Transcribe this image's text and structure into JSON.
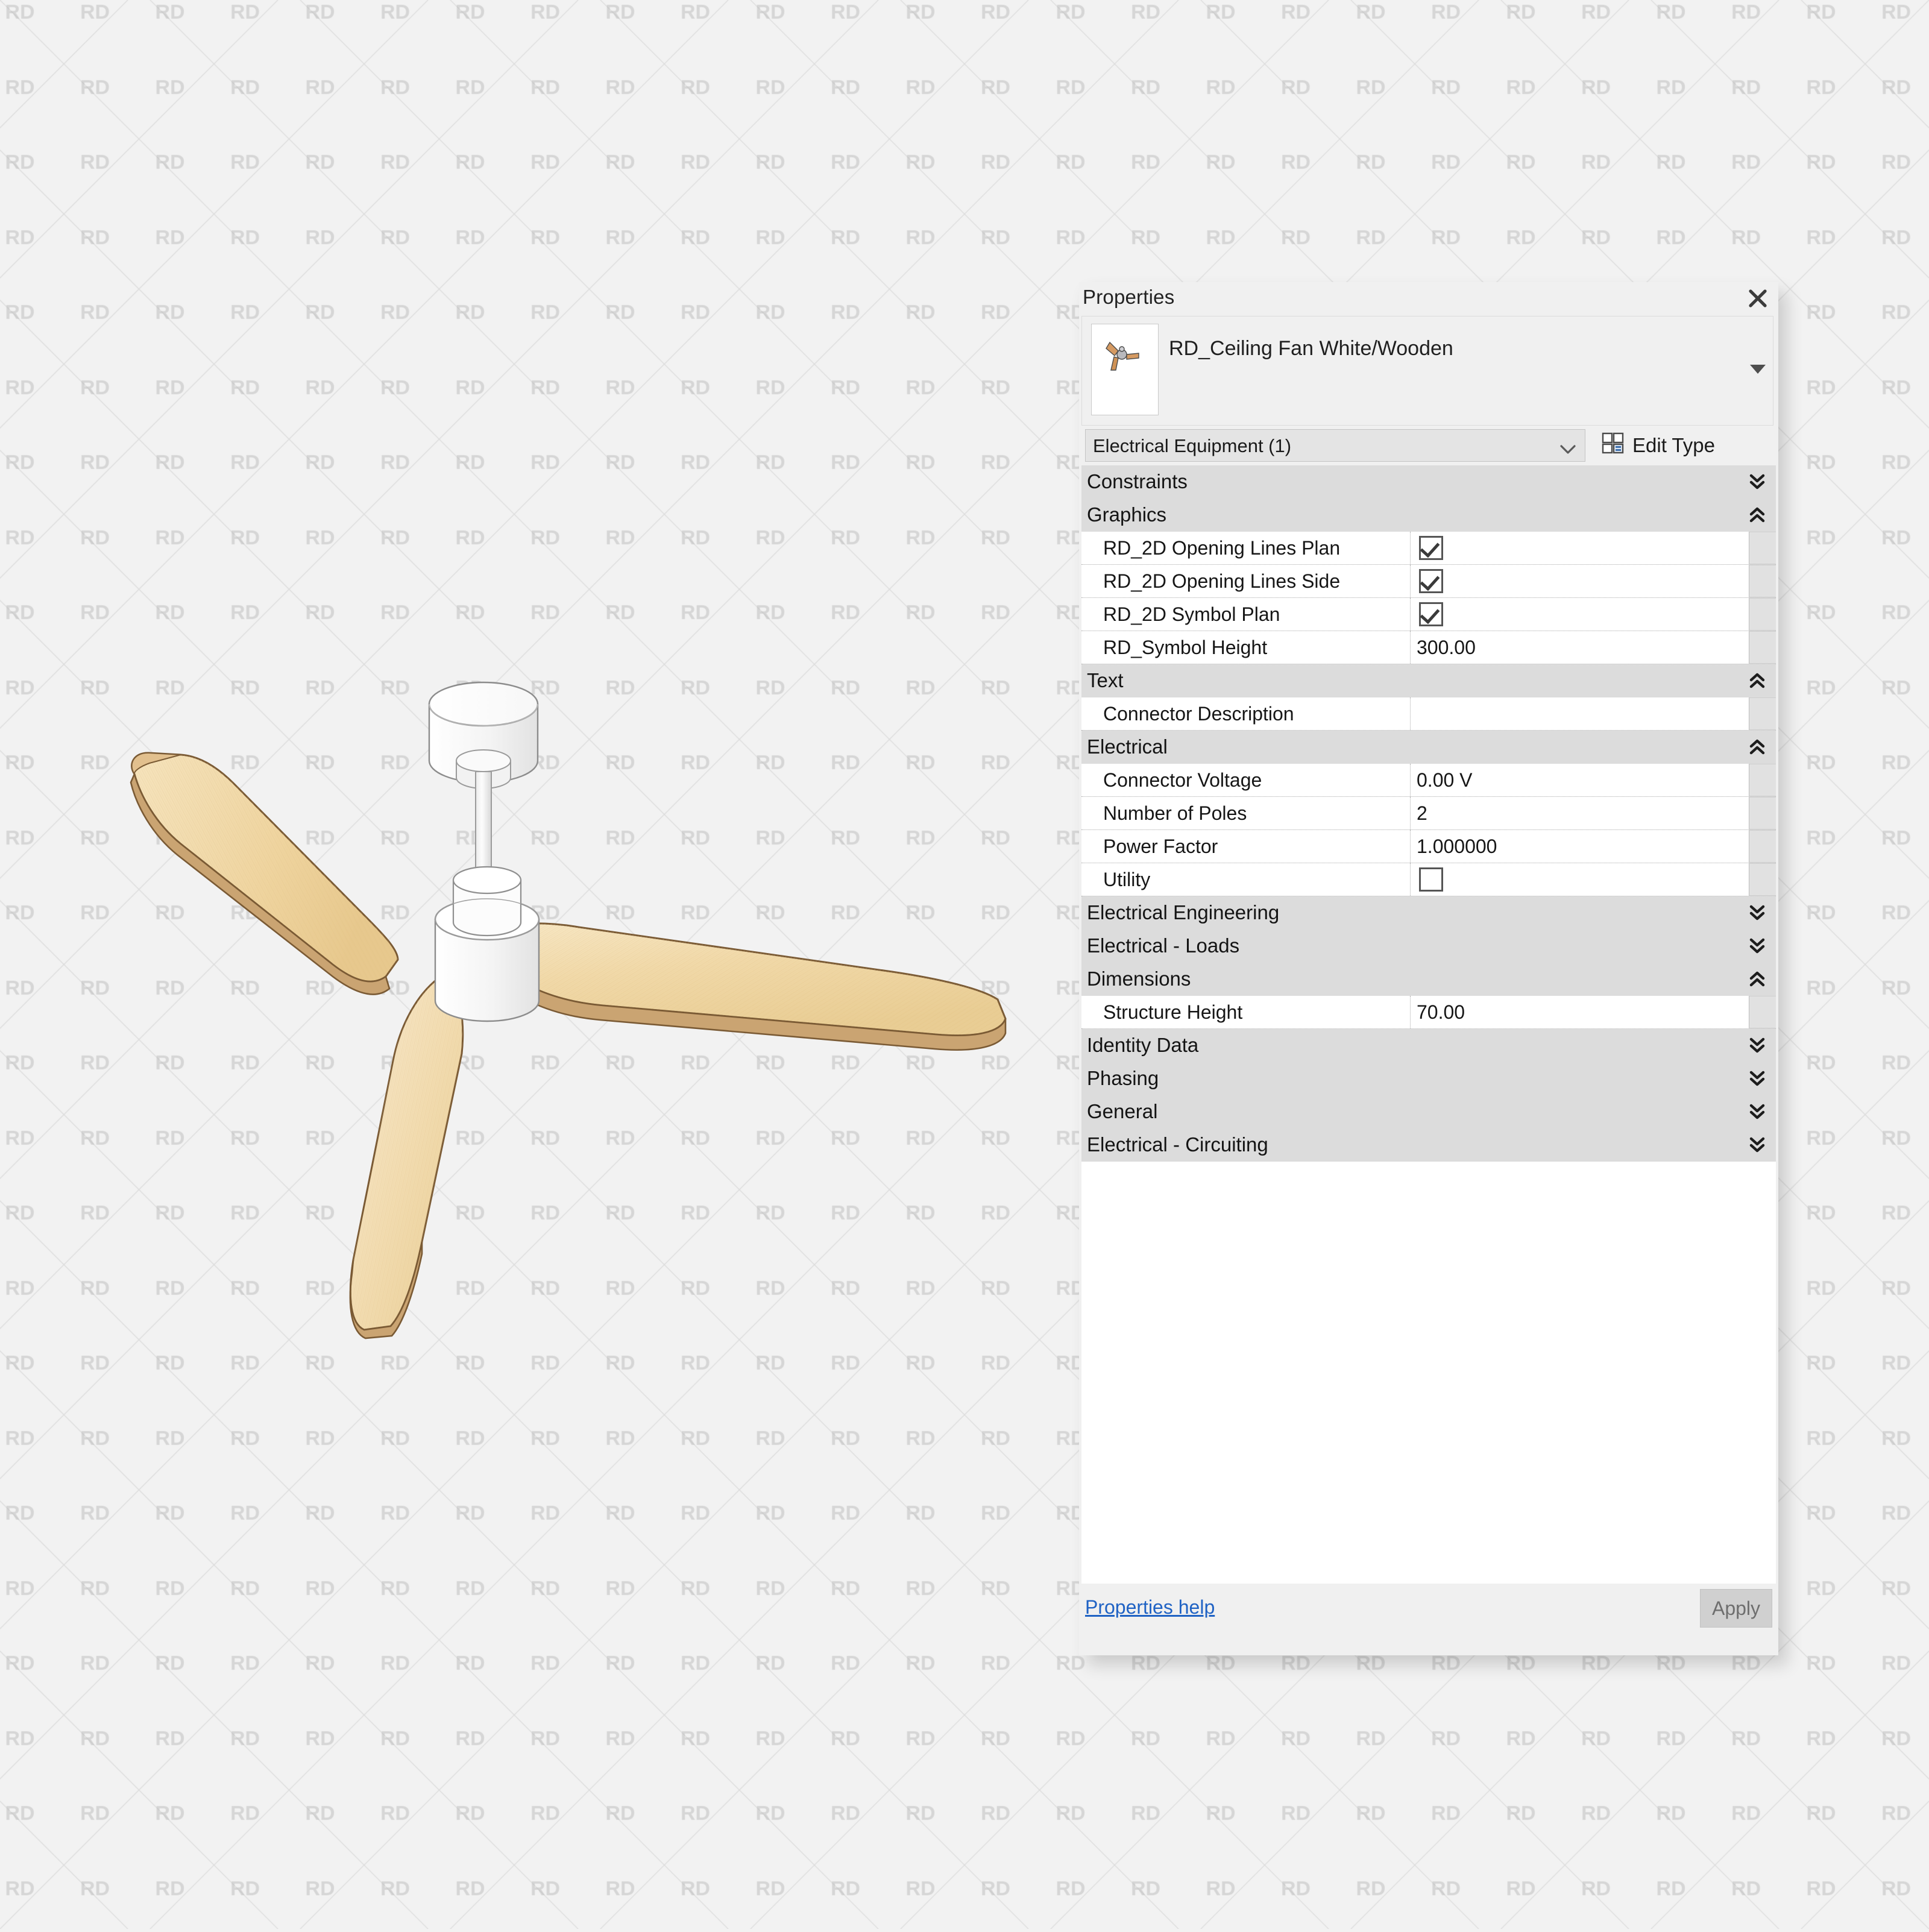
{
  "palette": {
    "title": "Properties",
    "close_icon": "close-icon",
    "family": {
      "name": "RD_Ceiling Fan White/Wooden",
      "thumbnail_icon": "ceiling-fan-thumbnail",
      "caret_icon": "caret-down-icon"
    },
    "type_selector": {
      "value": "Electrical Equipment (1)",
      "chevron_icon": "chevron-down-icon"
    },
    "edit_type": {
      "label": "Edit Type",
      "icon": "edit-type-icon"
    },
    "groups": [
      {
        "name": "Constraints",
        "state": "collapsed",
        "chevron_icon": "double-chevron-down-icon",
        "rows": []
      },
      {
        "name": "Graphics",
        "state": "expanded",
        "chevron_icon": "double-chevron-up-icon",
        "rows": [
          {
            "label": "RD_2D Opening Lines Plan",
            "type": "checkbox",
            "checked": true,
            "value": ""
          },
          {
            "label": "RD_2D Opening Lines Side",
            "type": "checkbox",
            "checked": true,
            "value": ""
          },
          {
            "label": "RD_2D Symbol Plan",
            "type": "checkbox",
            "checked": true,
            "value": ""
          },
          {
            "label": "RD_Symbol Height",
            "type": "text",
            "checked": false,
            "value": "300.00"
          }
        ]
      },
      {
        "name": "Text",
        "state": "expanded",
        "chevron_icon": "double-chevron-up-icon",
        "rows": [
          {
            "label": "Connector Description",
            "type": "text",
            "checked": false,
            "value": ""
          }
        ]
      },
      {
        "name": "Electrical",
        "state": "expanded",
        "chevron_icon": "double-chevron-up-icon",
        "rows": [
          {
            "label": "Connector Voltage",
            "type": "text",
            "checked": false,
            "value": "0.00 V"
          },
          {
            "label": "Number of Poles",
            "type": "text",
            "checked": false,
            "value": "2"
          },
          {
            "label": "Power Factor",
            "type": "text",
            "checked": false,
            "value": "1.000000"
          },
          {
            "label": "Utility",
            "type": "checkbox",
            "checked": false,
            "value": ""
          }
        ]
      },
      {
        "name": "Electrical Engineering",
        "state": "collapsed",
        "chevron_icon": "double-chevron-down-icon",
        "rows": []
      },
      {
        "name": "Electrical - Loads",
        "state": "collapsed",
        "chevron_icon": "double-chevron-down-icon",
        "rows": []
      },
      {
        "name": "Dimensions",
        "state": "expanded",
        "chevron_icon": "double-chevron-up-icon",
        "rows": [
          {
            "label": "Structure Height",
            "type": "text",
            "checked": false,
            "value": "70.00"
          }
        ]
      },
      {
        "name": "Identity Data",
        "state": "collapsed",
        "chevron_icon": "double-chevron-down-icon",
        "rows": []
      },
      {
        "name": "Phasing",
        "state": "collapsed",
        "chevron_icon": "double-chevron-down-icon",
        "rows": []
      },
      {
        "name": "General",
        "state": "collapsed",
        "chevron_icon": "double-chevron-down-icon",
        "rows": []
      },
      {
        "name": "Electrical - Circuiting",
        "state": "collapsed",
        "chevron_icon": "double-chevron-down-icon",
        "rows": []
      }
    ],
    "footer": {
      "help_label": "Properties help",
      "apply_label": "Apply"
    }
  },
  "canvas": {
    "watermark_text": "RD",
    "model_name": "ceiling-fan-3d-view",
    "background_color": "#f2f2f2"
  },
  "colors": {
    "panel_bg": "#f0f0f0",
    "group_header_bg": "#dcdcdc",
    "row_bg": "#ffffff",
    "link_blue": "#1f62c4",
    "blade_wood": "#f0d9a8",
    "blade_edge": "#b5793c",
    "hub_white": "#fdfdfd"
  }
}
